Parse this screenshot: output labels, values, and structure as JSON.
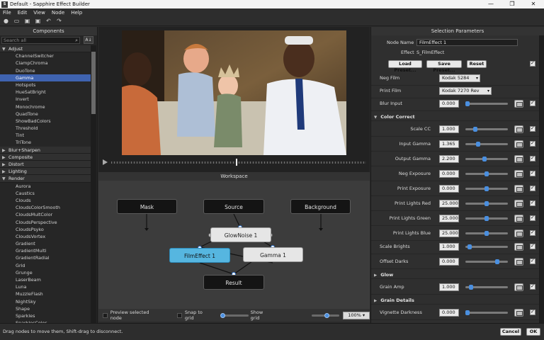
{
  "window": {
    "title": "Default - Sapphire Effect Builder",
    "app_icon": "S"
  },
  "menu": [
    "File",
    "Edit",
    "View",
    "Node",
    "Help"
  ],
  "components": {
    "header": "Components",
    "search_placeholder": "Search all",
    "categories": [
      {
        "label": "Adjust",
        "expanded": true,
        "items": [
          "ChannelSwitcher",
          "ClampChroma",
          "DuoTone",
          "Gamma",
          "Hotspots",
          "HueSatBright",
          "Invert",
          "Monochrome",
          "QuadTone",
          "ShowBadColors",
          "Threshold",
          "Tint",
          "TriTone"
        ]
      },
      {
        "label": "Blur+Sharpen",
        "expanded": false,
        "items": []
      },
      {
        "label": "Composite",
        "expanded": false,
        "items": []
      },
      {
        "label": "Distort",
        "expanded": false,
        "items": []
      },
      {
        "label": "Lighting",
        "expanded": false,
        "items": []
      },
      {
        "label": "Render",
        "expanded": true,
        "items": [
          "Aurora",
          "Caustics",
          "Clouds",
          "CloudsColorSmooth",
          "CloudsMultColor",
          "CloudsPerspective",
          "CloudsPsyko",
          "CloudsVortex",
          "Gradient",
          "GradientMulti",
          "GradientRadial",
          "Grid",
          "Grunge",
          "LaserBeam",
          "Luna",
          "MuzzleFlash",
          "NightSky",
          "Shape",
          "Sparkles",
          "SparklesColor"
        ]
      }
    ],
    "selected": "Gamma"
  },
  "workspace": {
    "header": "Workspace",
    "nodes": {
      "mask": "Mask",
      "source": "Source",
      "background": "Background",
      "glownoise": "GlowNoise 1",
      "filmeffect": "FilmEffect 1",
      "gamma": "Gamma 1",
      "result": "Result"
    },
    "preview_label": "Preview selected node",
    "snap_label": "Snap to grid",
    "show_grid_label": "Show grid",
    "zoom": "100%"
  },
  "selection": {
    "header": "Selection Parameters",
    "node_name_label": "Node Name",
    "node_name": "FilmEffect 1",
    "effect_label": "Effect",
    "effect": "S_FilmEffect",
    "load_preset": "Load Preset...",
    "save_preset": "Save Preset...",
    "reset": "Reset",
    "neg_film_label": "Neg Film",
    "neg_film": "Kodak 5284",
    "print_film_label": "Print Film",
    "print_film": "Kodak 7270 Rev",
    "blur_input_label": "Blur Input",
    "blur_input": "0.000",
    "blur_input_level": 0.0,
    "color_correct_section": "Color Correct",
    "color_correct": [
      {
        "label": "Scale CC",
        "value": "1.000",
        "level": 0.2
      },
      {
        "label": "Input Gamma",
        "value": "1.365",
        "level": 0.28
      },
      {
        "label": "Output Gamma",
        "value": "2.200",
        "level": 0.44
      },
      {
        "label": "Neg Exposure",
        "value": "0.000",
        "level": 0.5
      },
      {
        "label": "Print Exposure",
        "value": "0.000",
        "level": 0.5
      },
      {
        "label": "Print Lights Red",
        "value": "25.000",
        "level": 0.5
      },
      {
        "label": "Print Lights Green",
        "value": "25.000",
        "level": 0.5
      },
      {
        "label": "Print Lights Blue",
        "value": "25.000",
        "level": 0.5
      }
    ],
    "scale_brights_label": "Scale Brights",
    "scale_brights": "1.000",
    "scale_brights_level": 0.05,
    "offset_darks_label": "Offset Darks",
    "offset_darks": "0.000",
    "offset_darks_level": 0.78,
    "glow_section": "Glow",
    "grain_amp_label": "Grain Amp",
    "grain_amp": "1.000",
    "grain_amp_level": 0.1,
    "grain_section": "Grain Details",
    "vignette_label": "Vignette Darkness",
    "vignette": "0.000",
    "vignette_level": 0.0
  },
  "status": {
    "message": "Drag nodes to move them, Shift-drag to disconnect.",
    "cancel": "Cancel",
    "ok": "OK"
  },
  "colors": {
    "selection": "#3f63b0",
    "node_selected": "#56b6e0",
    "slider_knob": "#4a8fe0"
  }
}
